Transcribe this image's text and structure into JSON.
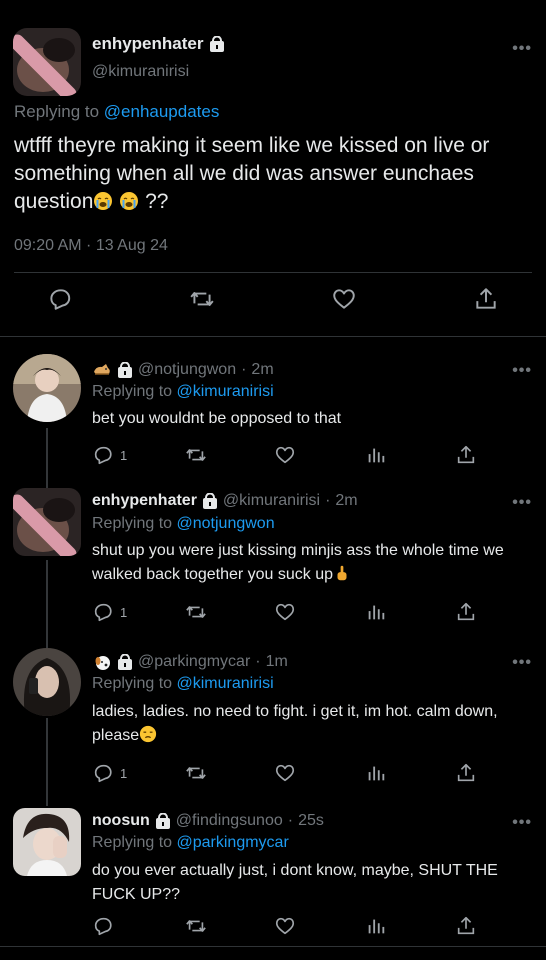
{
  "main": {
    "name": "enhypenhater",
    "handle": "@kimuranirisi",
    "replying_prefix": "Replying to ",
    "replying_to": "@enhaupdates",
    "text": "wtfff theyre making it seem like we kissed on live or something when all we did was answer eunchaes question",
    "text_tail": "??",
    "timestamp": "09:20 AM · 13 Aug 24",
    "actions": [
      "reply-icon",
      "retweet-icon",
      "like-icon",
      "share-icon"
    ]
  },
  "replies": [
    {
      "name": "",
      "handle": "@notjungwon",
      "time": "2m",
      "replying_prefix": "Replying to ",
      "replying_to": "@kimuranirisi",
      "text": "bet you wouldnt be opposed to that",
      "reply_count": "1"
    },
    {
      "name": "enhypenhater",
      "handle": "@kimuranirisi",
      "time": "2m",
      "replying_prefix": "Replying to ",
      "replying_to": "@notjungwon",
      "text": "shut up you were just kissing minjis ass the whole time we walked back together you suck up",
      "reply_count": "1"
    },
    {
      "name": "",
      "handle": "@parkingmycar",
      "time": "1m",
      "replying_prefix": "Replying to ",
      "replying_to": "@kimuranirisi",
      "text": "ladies, ladies. no need to fight. i get it, im hot. calm down, please",
      "reply_count": "1"
    },
    {
      "name": "noosun",
      "handle": "@findingsunoo",
      "time": "25s",
      "replying_prefix": "Replying to ",
      "replying_to": "@parkingmycar",
      "text": "do you ever actually just, i dont know, maybe, SHUT THE FUCK UP??",
      "reply_count": ""
    }
  ],
  "separator": " · ",
  "colors": {
    "background": "#000000",
    "text": "#e7e9ea",
    "muted": "#71767b",
    "link": "#1d9bf0",
    "border": "#2f3336"
  }
}
